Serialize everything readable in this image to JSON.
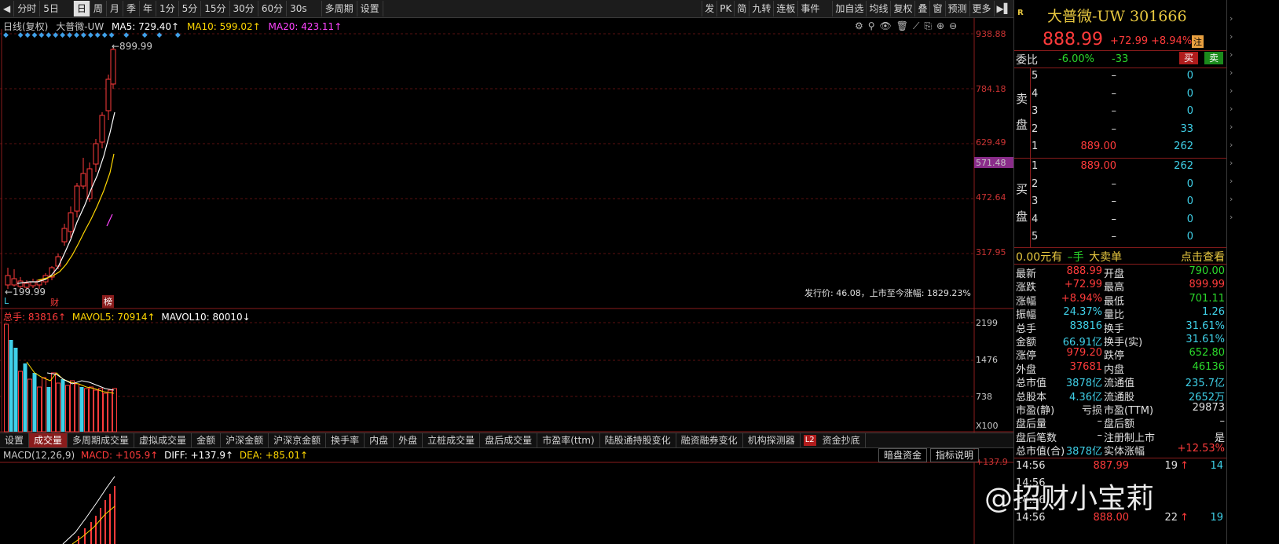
{
  "toolbar": {
    "left_items": [
      "分时",
      "5日",
      "日",
      "周",
      "月",
      "季",
      "年",
      "1分",
      "5分",
      "15分",
      "30分",
      "60分",
      "30s",
      "多周期",
      "设置"
    ],
    "active": "日",
    "right_items": [
      "发",
      "PK",
      "简",
      "九转",
      "连板",
      "事件",
      "加自选",
      "均线",
      "复权",
      "叠",
      "窗",
      "预测",
      "更多"
    ]
  },
  "chart": {
    "header": "日线(复权)",
    "stock_name": "大普微-UW",
    "ma5": "MA5: 729.40↑",
    "ma10": "MA10: 599.02↑",
    "ma20": "MA20: 423.11↑",
    "high_label": "←899.99",
    "low_label": "←199.99",
    "markers": [
      "L",
      "财",
      "榜"
    ],
    "ipo_text": "发行价: 46.08，上市至今涨幅: 1829.23%",
    "y_axis": [
      "938.88",
      "784.18",
      "629.49",
      "571.48",
      "472.64",
      "317.95"
    ],
    "colors": {
      "up": "#ff3b3b",
      "ma5": "#ffffff",
      "ma10": "#ffd700",
      "ma20": "#ff44ff",
      "grid": "#5a1010",
      "current": "#8a2c8a"
    }
  },
  "volume": {
    "total": "总手: 83816↑",
    "mavol5": "MAVOL5: 70914↑",
    "mavol10": "MAVOL10: 80010↓",
    "y_axis": [
      "2199",
      "1476",
      "738",
      "X100"
    ],
    "colors": {
      "up": "#ff3b3b",
      "down": "#3fd0e8"
    }
  },
  "tabs": [
    "设置",
    "成交量",
    "多周期成交量",
    "虚拟成交量",
    "金额",
    "沪深金额",
    "沪深京金额",
    "换手率",
    "内盘",
    "外盘",
    "立桩成交量",
    "盘后成交量",
    "市盈率(ttm)",
    "陆股通持股变化",
    "融资融券变化",
    "机构探测器",
    "资金抄底"
  ],
  "active_tab": "成交量",
  "l2_badge": "L2",
  "macd": {
    "label": "MACD(12,26,9)",
    "macd_val": "MACD: +105.9↑",
    "diff": "DIFF: +137.9↑",
    "dea": "DEA: +85.01↑",
    "buttons": [
      "暗盘资金",
      "指标说明"
    ],
    "axis_top": "+137.9"
  },
  "panel": {
    "r_tag": "R",
    "title": "大普微-UW 301666",
    "price": "888.99",
    "change": "+72.99",
    "pct": "+8.94%",
    "note_tag": "注",
    "weibi_label": "委比",
    "weibi": "-6.00%",
    "weicha": "-33",
    "buy_btn": "买",
    "sell_btn": "卖",
    "sell_label": [
      "卖",
      "盘"
    ],
    "buy_label": [
      "买",
      "盘"
    ],
    "asks": [
      {
        "level": "5",
        "price": "–",
        "vol": "0"
      },
      {
        "level": "4",
        "price": "–",
        "vol": "0"
      },
      {
        "level": "3",
        "price": "–",
        "vol": "0"
      },
      {
        "level": "2",
        "price": "–",
        "vol": "33"
      },
      {
        "level": "1",
        "price": "889.00",
        "vol": "262"
      }
    ],
    "bids": [
      {
        "level": "1",
        "price": "889.00",
        "vol": "262"
      },
      {
        "level": "2",
        "price": "–",
        "vol": "0"
      },
      {
        "level": "3",
        "price": "–",
        "vol": "0"
      },
      {
        "level": "4",
        "price": "–",
        "vol": "0"
      },
      {
        "level": "5",
        "price": "–",
        "vol": "0"
      }
    ],
    "bigorder": {
      "amount": "0.00元有",
      "hands": "–手",
      "text": "大卖单",
      "link": "点击查看"
    },
    "stats": [
      [
        "最新",
        "888.99",
        "开盘",
        "790.00"
      ],
      [
        "涨跌",
        "+72.99",
        "最高",
        "899.99"
      ],
      [
        "涨幅",
        "+8.94%",
        "最低",
        "701.11"
      ],
      [
        "振幅",
        "24.37%",
        "量比",
        "1.26"
      ],
      [
        "总手",
        "83816",
        "换手",
        "31.61%"
      ],
      [
        "金额",
        "66.91亿",
        "换手(实)",
        "31.61%"
      ],
      [
        "涨停",
        "979.20",
        "跌停",
        "652.80"
      ],
      [
        "外盘",
        "37681",
        "内盘",
        "46136"
      ],
      [
        "总市值",
        "3878亿",
        "流通值",
        "235.7亿"
      ],
      [
        "总股本",
        "4.36亿",
        "流通股",
        "2652万"
      ],
      [
        "市盈(静)",
        "亏损",
        "市盈(TTM)",
        "29873"
      ],
      [
        "盘后量",
        "–",
        "盘后额",
        "–"
      ],
      [
        "盘后笔数",
        "–",
        "注册制上市",
        "是"
      ],
      [
        "总市值(合)",
        "3878亿",
        "实体涨幅",
        "+12.53%"
      ]
    ],
    "ticks": [
      {
        "time": "14:56",
        "price": "887.99",
        "vol": "19",
        "arrow": "↑",
        "n": "14"
      },
      {
        "time": "14:56",
        "price": "",
        "vol": "",
        "arrow": "",
        "n": ""
      },
      {
        "time": "14:56",
        "price": "",
        "vol": "",
        "arrow": "",
        "n": ""
      },
      {
        "time": "14:56",
        "price": "888.00",
        "vol": "22",
        "arrow": "↑",
        "n": "19"
      }
    ],
    "watermark": "@招财小宝莉"
  }
}
